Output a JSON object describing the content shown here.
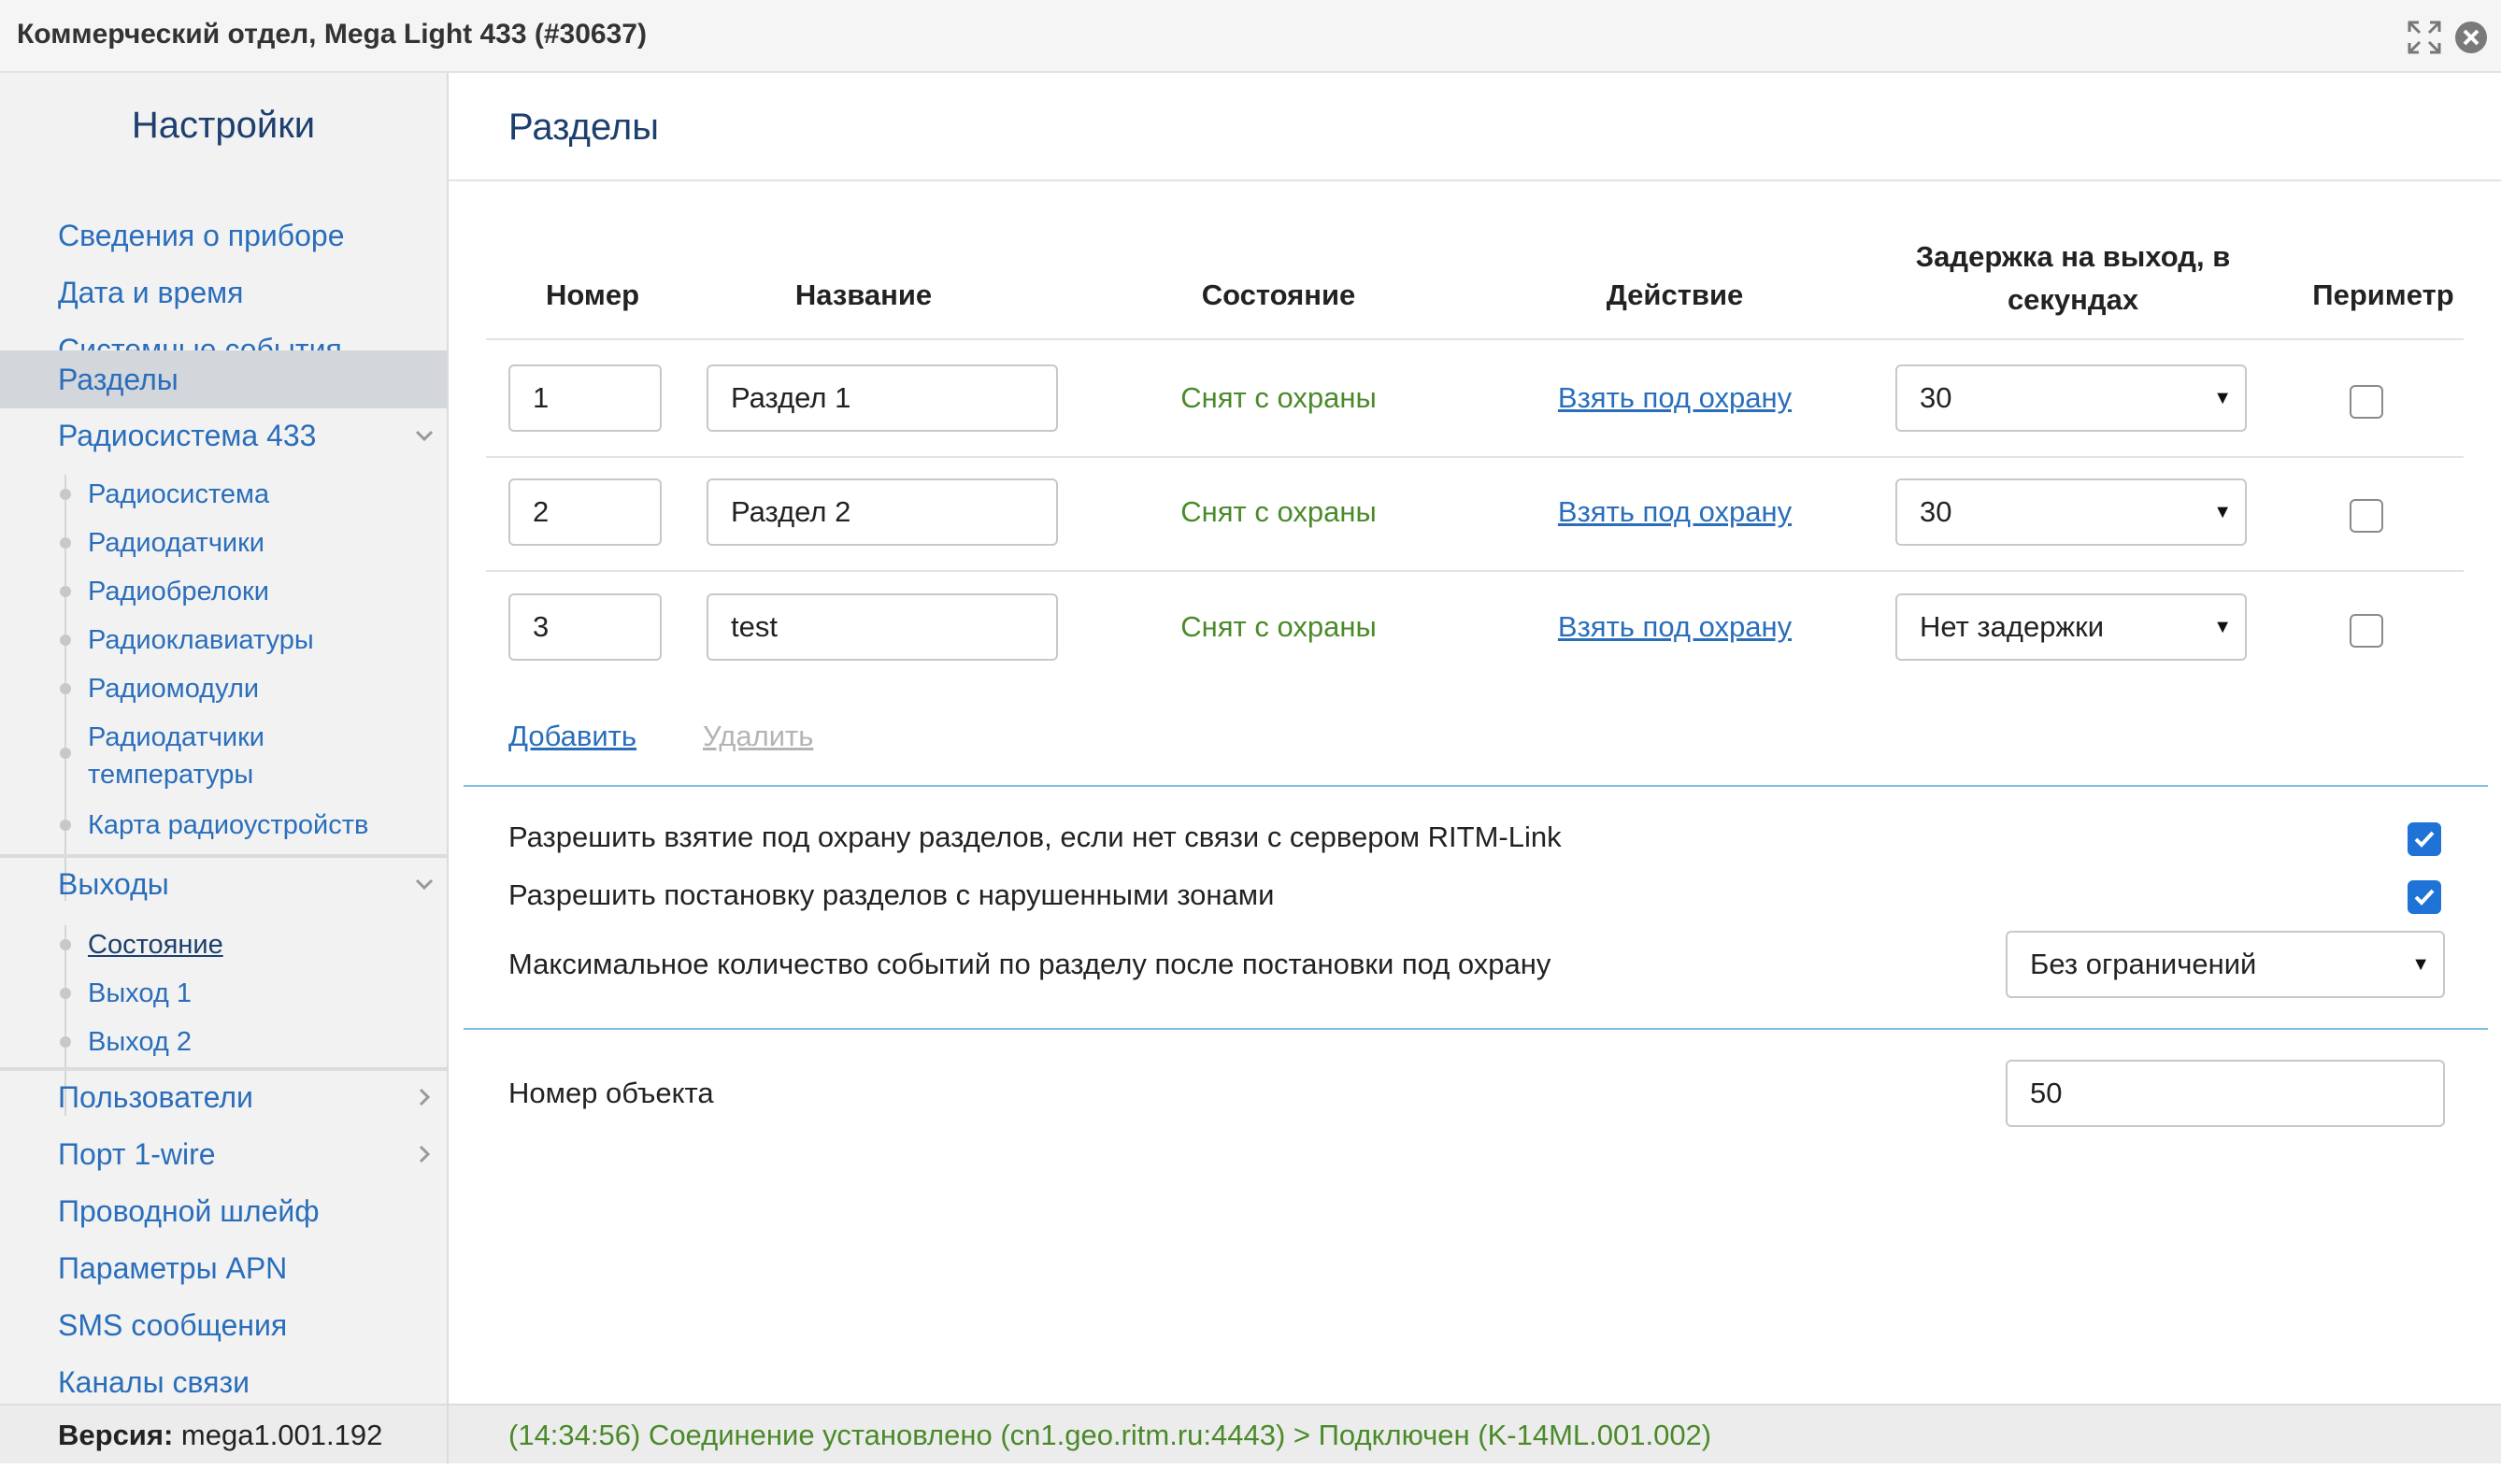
{
  "window": {
    "title": "Коммерческий отдел, Mega Light 433 (#30637)"
  },
  "sidebar": {
    "title": "Настройки",
    "items": [
      {
        "label": "Сведения о приборе"
      },
      {
        "label": "Дата и время"
      },
      {
        "label": "Системные события"
      },
      {
        "label": "Разделы",
        "active": true
      },
      {
        "label": "Радиосистема 433",
        "expanded": true
      },
      {
        "label": "Выходы",
        "expanded": true
      },
      {
        "label": "Пользователи"
      },
      {
        "label": "Порт 1-wire"
      },
      {
        "label": "Проводной шлейф"
      },
      {
        "label": "Параметры APN"
      },
      {
        "label": "SMS сообщения"
      },
      {
        "label": "Каналы связи"
      }
    ],
    "radio_subitems": [
      {
        "label": "Радиосистема"
      },
      {
        "label": "Радиодатчики"
      },
      {
        "label": "Радиобрелоки"
      },
      {
        "label": "Радиоклавиатуры"
      },
      {
        "label": "Радиомодули"
      },
      {
        "label": "Радиодатчики температуры"
      },
      {
        "label": "Карта радиоустройств"
      }
    ],
    "outputs_subitems": [
      {
        "label": "Состояние",
        "selected": true
      },
      {
        "label": "Выход 1"
      },
      {
        "label": "Выход 2"
      }
    ]
  },
  "main": {
    "title": "Разделы",
    "columns": {
      "number": "Номер",
      "name": "Название",
      "state": "Состояние",
      "action": "Действие",
      "delay": "Задержка на выход, в секундах",
      "perimeter": "Периметр"
    },
    "rows": [
      {
        "number": "1",
        "name": "Раздел 1",
        "state": "Снят с охраны",
        "action": "Взять под охрану",
        "delay": "30",
        "perimeter": false
      },
      {
        "number": "2",
        "name": "Раздел 2",
        "state": "Снят с охраны",
        "action": "Взять под охрану",
        "delay": "30",
        "perimeter": false
      },
      {
        "number": "3",
        "name": "test",
        "state": "Снят с охраны",
        "action": "Взять под охрану",
        "delay": "Нет задержки",
        "perimeter": false
      }
    ],
    "add_label": "Добавить",
    "delete_label": "Удалить",
    "options": {
      "allow_arm_no_link": {
        "label": "Разрешить взятие под охрану разделов, если нет связи с сервером RITM-Link",
        "checked": true
      },
      "allow_arm_violated": {
        "label": "Разрешить постановку разделов с нарушенными зонами",
        "checked": true
      },
      "max_events": {
        "label": "Максимальное количество событий по разделу после постановки под охрану",
        "value": "Без ограничений"
      }
    },
    "object_number": {
      "label": "Номер объекта",
      "value": "50"
    }
  },
  "footer": {
    "version_label": "Версия:",
    "version_value": "mega1.001.192",
    "status": "(14:34:56) Соединение установлено (cn1.geo.ritm.ru:4443) > Подключен (K-14ML.001.002)"
  },
  "colors": {
    "accent": "#2a6ebb",
    "title": "#1d3f6e",
    "ok_green": "#4a8a2a",
    "checkbox": "#1f73d6"
  },
  "icons": [
    "expand-icon",
    "close-icon",
    "chevron-down-icon",
    "chevron-right-icon",
    "dropdown-arrow-icon",
    "checkmark-icon"
  ]
}
